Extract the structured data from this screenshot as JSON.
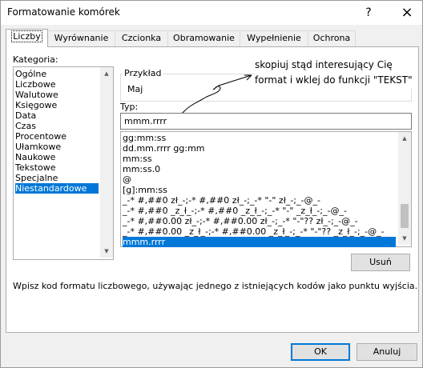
{
  "window": {
    "title": "Formatowanie komórek",
    "help": "?",
    "close": "×"
  },
  "tabs": [
    "Liczby",
    "Wyrównanie",
    "Czcionka",
    "Obramowanie",
    "Wypełnienie",
    "Ochrona"
  ],
  "category": {
    "label": "Kategoria:",
    "items": [
      "Ogólne",
      "Liczbowe",
      "Walutowe",
      "Księgowe",
      "Data",
      "Czas",
      "Procentowe",
      "Ułamkowe",
      "Naukowe",
      "Tekstowe",
      "Specjalne",
      "Niestandardowe"
    ],
    "selected": "Niestandardowe"
  },
  "sample": {
    "label": "Przykład",
    "value": "Maj"
  },
  "annotation": {
    "line1": "skopiuj stąd interesujący Cię",
    "line2": "format i wklej do funkcji \"TEKST\""
  },
  "type": {
    "label": "Typ:",
    "value": "mmm.rrrr",
    "formats": [
      "gg:mm:ss",
      "dd.mm.rrrr gg:mm",
      "mm:ss",
      "mm:ss.0",
      "@",
      "[g]:mm:ss",
      "_-* #,##0 zł_-;-* #,##0 zł_-;_-* \"-\" zł_-;_-@_-",
      "_-* #,##0 _z_ł_-;-* #,##0 _z_ł_-;_-* \"-\" _z_ł_-;_-@_-",
      "_-* #,##0.00 zł_-;-* #,##0.00 zł_-;_-* \"-\"?? zł_-;_-@_-",
      "_-* #,##0.00 _z_ł_-;-* #,##0.00 _z_ł_-;_-* \"-\"?? _z_ł_-;_-@_-",
      "mmm.rrrr"
    ],
    "selected": "mmm.rrrr"
  },
  "delete_button": "Usuń",
  "description": "Wpisz kod formatu liczbowego, używając jednego z istniejących kodów jako punktu wyjścia.",
  "ok_button": "OK",
  "cancel_button": "Anuluj"
}
